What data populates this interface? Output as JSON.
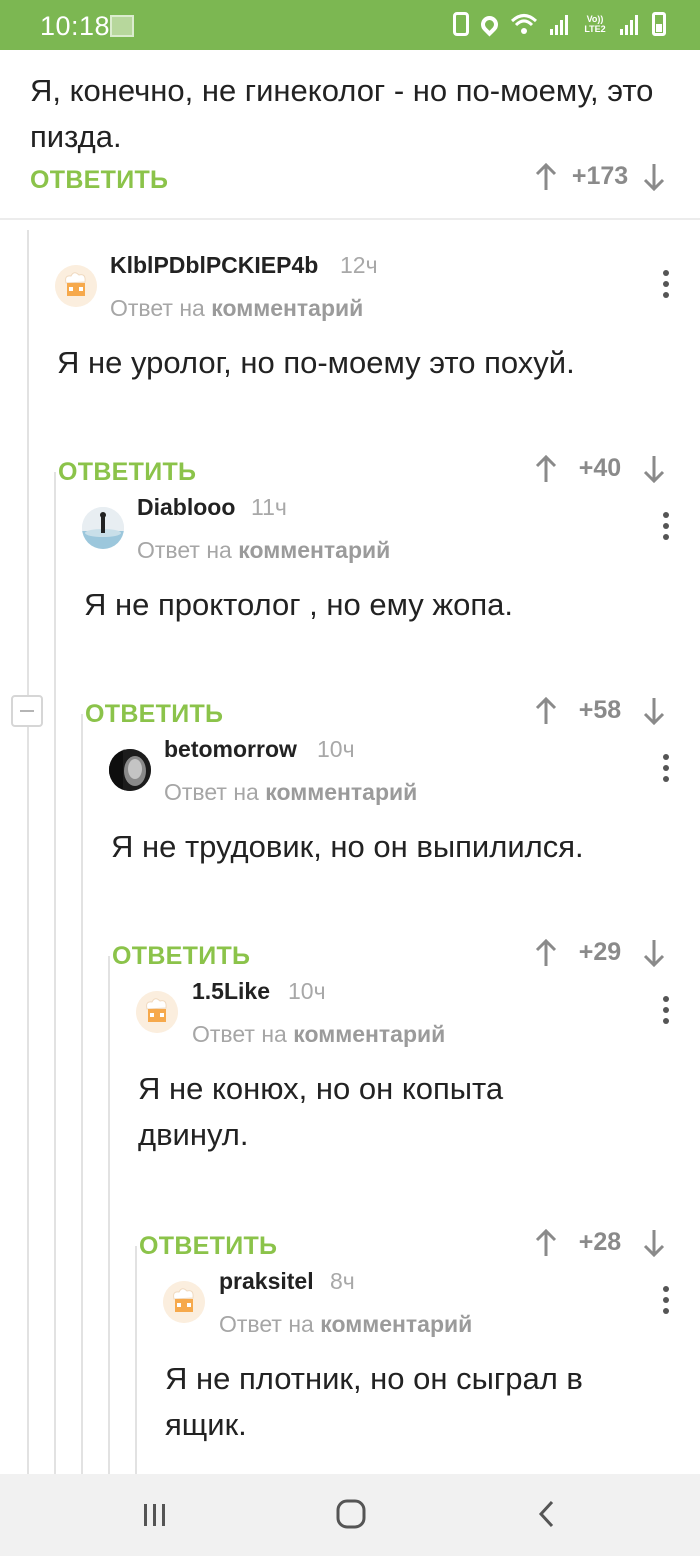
{
  "status_bar": {
    "time": "10:18",
    "network": "Vo)) LTE2",
    "icons": [
      "sim-icon",
      "battery-saver-icon",
      "location-icon",
      "wifi-icon",
      "signal-icon",
      "volte-icon",
      "signal-icon",
      "battery-icon"
    ]
  },
  "top_comment": {
    "text": "Я, конечно, не гинеколог - но по-моему, это пизда.",
    "reply_label": "ОТВЕТИТЬ",
    "score": "+173"
  },
  "comments": [
    {
      "username": "KlblPDblPCKIEP4b",
      "time": "12ч",
      "reply_prefix": "Ответ на",
      "reply_target": "комментарий",
      "text": "Я не уролог, но по-моему это похуй.",
      "reply_label": "ОТВЕТИТЬ",
      "score": "+40",
      "avatar": "default-chef-avatar"
    },
    {
      "username": "Diablooo",
      "time": "11ч",
      "reply_prefix": "Ответ на",
      "reply_target": "комментарий",
      "text": "Я не проктолог , но ему жопа.",
      "reply_label": "ОТВЕТИТЬ",
      "score": "+58",
      "avatar": "photo-avatar"
    },
    {
      "username": "betomorrow",
      "time": "10ч",
      "reply_prefix": "Ответ на",
      "reply_target": "комментарий",
      "text": "Я не трудовик, но он выпилился.",
      "reply_label": "ОТВЕТИТЬ",
      "score": "+29",
      "avatar": "dark-photo-avatar"
    },
    {
      "username": "1.5Like",
      "time": "10ч",
      "reply_prefix": "Ответ на",
      "reply_target": "комментарий",
      "text": "Я не конюх, но он копыта двинул.",
      "reply_label": "ОТВЕТИТЬ",
      "score": "+28",
      "avatar": "default-chef-avatar"
    },
    {
      "username": "praksitel",
      "time": "8ч",
      "reply_prefix": "Ответ на",
      "reply_target": "комментарий",
      "text": "Я не плотник, но он сыграл в ящик.",
      "reply_label": "",
      "score": "",
      "avatar": "default-chef-avatar"
    }
  ],
  "colors": {
    "accent": "#7cb752",
    "reply_green": "#8bc34a",
    "muted": "#a6a6a6"
  },
  "nav_bar": {
    "buttons": [
      "recents-icon",
      "home-icon",
      "back-icon"
    ]
  }
}
